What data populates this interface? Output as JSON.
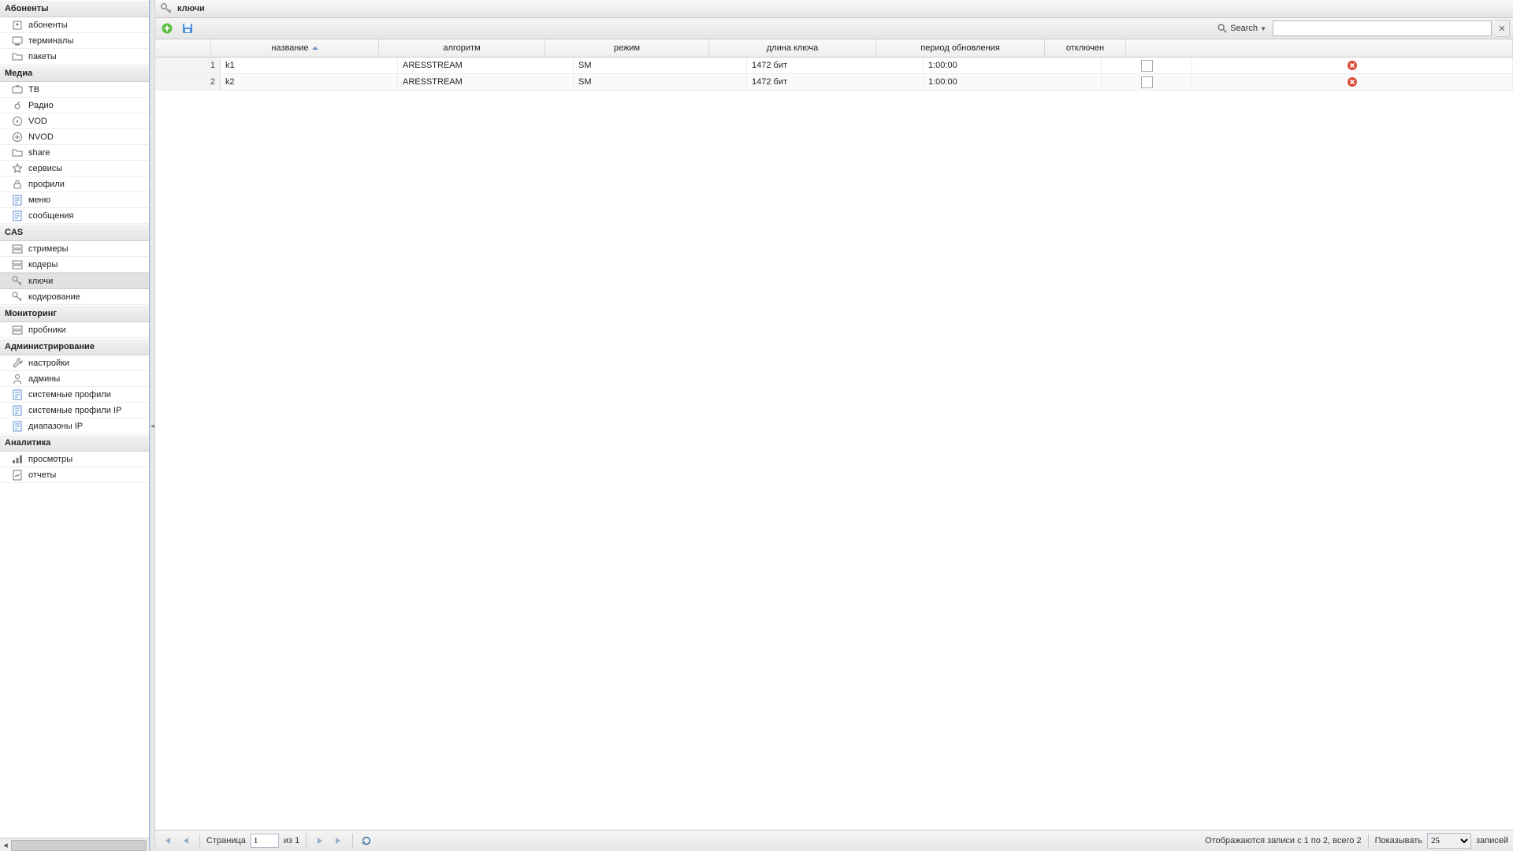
{
  "panel_title": "ключи",
  "sidebar": {
    "groups": [
      {
        "title": "Абоненты",
        "items": [
          {
            "label": "абоненты",
            "icon": "user"
          },
          {
            "label": "терминалы",
            "icon": "terminal"
          },
          {
            "label": "пакеты",
            "icon": "folder"
          }
        ]
      },
      {
        "title": "Медиа",
        "items": [
          {
            "label": "ТВ",
            "icon": "tv"
          },
          {
            "label": "Радио",
            "icon": "radio"
          },
          {
            "label": "VOD",
            "icon": "vod"
          },
          {
            "label": "NVOD",
            "icon": "nvod"
          },
          {
            "label": "share",
            "icon": "folder"
          },
          {
            "label": "сервисы",
            "icon": "star"
          },
          {
            "label": "профили",
            "icon": "lock"
          },
          {
            "label": "меню",
            "icon": "form"
          },
          {
            "label": "сообщения",
            "icon": "form"
          }
        ]
      },
      {
        "title": "CAS",
        "items": [
          {
            "label": "стримеры",
            "icon": "server"
          },
          {
            "label": "кодеры",
            "icon": "server"
          },
          {
            "label": "ключи",
            "icon": "key",
            "selected": true
          },
          {
            "label": "кодирование",
            "icon": "key"
          }
        ]
      },
      {
        "title": "Мониторинг",
        "items": [
          {
            "label": "пробники",
            "icon": "server"
          }
        ]
      },
      {
        "title": "Администрирование",
        "items": [
          {
            "label": "настройки",
            "icon": "wrench"
          },
          {
            "label": "админы",
            "icon": "admin"
          },
          {
            "label": "системные профили",
            "icon": "form"
          },
          {
            "label": "системные профили IP",
            "icon": "form"
          },
          {
            "label": "диапазоны IP",
            "icon": "form"
          }
        ]
      },
      {
        "title": "Аналитика",
        "items": [
          {
            "label": "просмотры",
            "icon": "views"
          },
          {
            "label": "отчеты",
            "icon": "report"
          }
        ]
      }
    ]
  },
  "toolbar": {
    "search_label": "Search"
  },
  "grid": {
    "columns": [
      "название",
      "алгоритм",
      "режим",
      "длина ключа",
      "период обновления",
      "отключен"
    ],
    "rows": [
      {
        "n": "1",
        "name": "k1",
        "alg": "ARESSTREAM",
        "mode": "SM",
        "len": "1472 бит",
        "upd": "1:00:00",
        "off": false
      },
      {
        "n": "2",
        "name": "k2",
        "alg": "ARESSTREAM",
        "mode": "SM",
        "len": "1472 бит",
        "upd": "1:00:00",
        "off": false
      }
    ]
  },
  "paging": {
    "page_label": "Страница",
    "page_value": "1",
    "of_label": "из 1",
    "display": "Отображаются записи с 1 по 2, всего 2",
    "show_label": "Показывать",
    "page_size": "25",
    "records_label": "записей"
  }
}
